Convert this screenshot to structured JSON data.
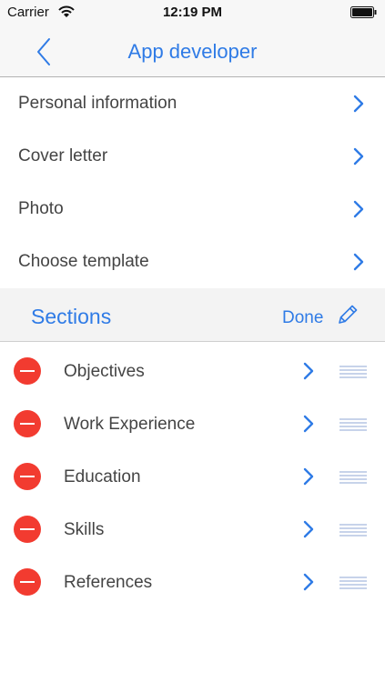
{
  "status_bar": {
    "carrier": "Carrier",
    "time": "12:19 PM",
    "wifi_icon": "wifi-icon",
    "battery_icon": "battery-icon"
  },
  "nav": {
    "title": "App developer",
    "back_icon": "chevron-left-icon"
  },
  "menu": {
    "items": [
      {
        "label": "Personal information"
      },
      {
        "label": "Cover letter"
      },
      {
        "label": "Photo"
      },
      {
        "label": "Choose template"
      }
    ]
  },
  "sections": {
    "title": "Sections",
    "done_label": "Done",
    "edit_icon": "pencil-icon",
    "items": [
      {
        "label": "Objectives"
      },
      {
        "label": "Work Experience"
      },
      {
        "label": "Education"
      },
      {
        "label": "Skills"
      },
      {
        "label": "References"
      }
    ]
  },
  "colors": {
    "accent": "#2f7be6",
    "delete": "#f23b30",
    "text": "#444444",
    "header_bg": "#f7f7f7"
  }
}
